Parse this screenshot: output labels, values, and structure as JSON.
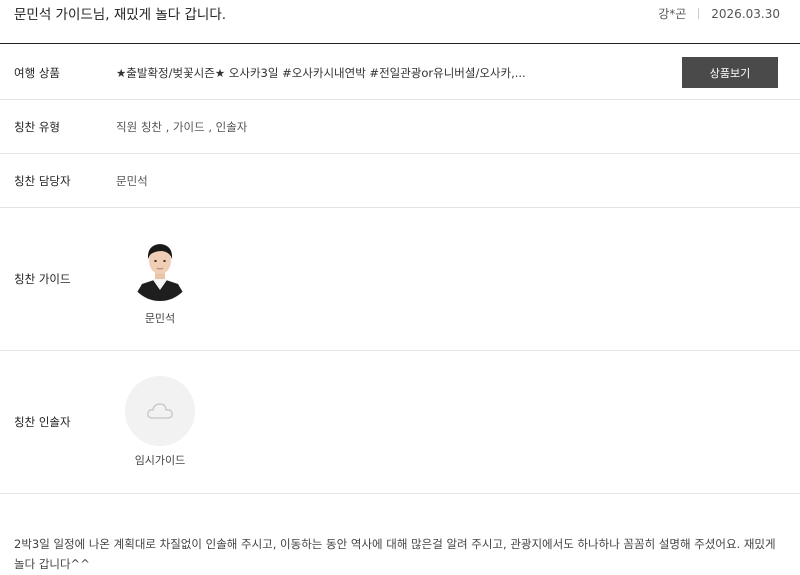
{
  "header": {
    "title": "문민석 가이드님, 재밌게 놀다 갑니다.",
    "author": "강*곤",
    "date": "2026.03.30"
  },
  "rows": {
    "product": {
      "label": "여행 상품",
      "value": "★출발확정/벚꽃시즌★ 오사카3일 #오사카시내연박 #전일관광or유니버셜/오사카,...",
      "button_label": "상품보기"
    },
    "type": {
      "label": "칭찬 유형",
      "value": "직원 칭찬 , 가이드 , 인솔자"
    },
    "staff": {
      "label": "칭찬 담당자",
      "value": "문민석"
    },
    "guide": {
      "label": "칭찬 가이드",
      "name": "문민석"
    },
    "escort": {
      "label": "칭찬 인솔자",
      "name": "임시가이드"
    }
  },
  "review": {
    "text": "2박3일 일정에 나온 계획대로 차질없이 인솔해 주시고, 이동하는 동안 역사에 대해 많은걸 알려 주시고, 관광지에서도 하나하나 꼼꼼히 설명해 주셨어요. 재밌게 놀다 갑니다^^"
  },
  "colors": {
    "button_bg": "#4a4a4a",
    "divider": "#e4e4e4",
    "header_border": "#222222"
  },
  "icons": {
    "escort_placeholder": "cloud-icon"
  }
}
